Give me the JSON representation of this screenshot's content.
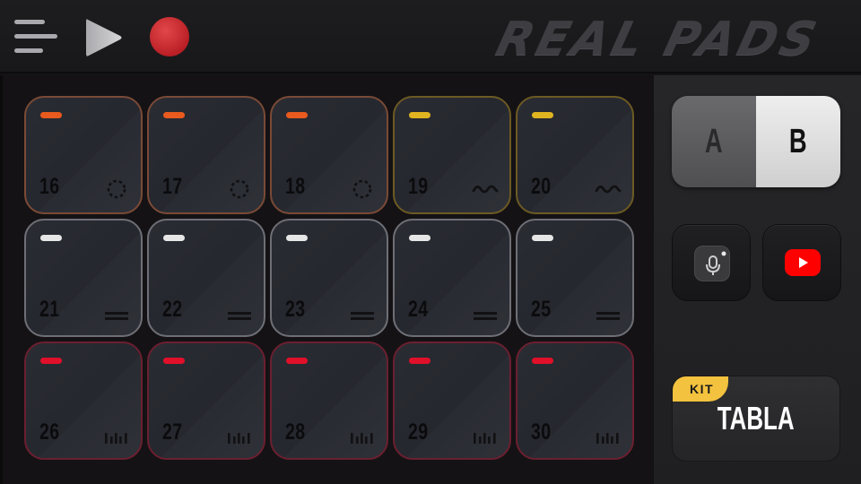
{
  "app": {
    "brand": "REAL PADS"
  },
  "toolbar": {
    "menu_icon": "hamburger-menu-icon",
    "play_icon": "play-icon",
    "record_icon": "record-icon"
  },
  "colors": {
    "orange": "#e85a1e",
    "yellow": "#e0b420",
    "white": "#e6e6e6",
    "red": "#e0102a",
    "orange_border": "#7a4a36",
    "yellow_border": "#6c5a23",
    "white_border": "#6e6f76",
    "red_border": "#6b1f30"
  },
  "pads": [
    {
      "number": "16",
      "color": "orange",
      "icon": "dotted-circle"
    },
    {
      "number": "17",
      "color": "orange",
      "icon": "dotted-circle"
    },
    {
      "number": "18",
      "color": "orange",
      "icon": "dotted-circle"
    },
    {
      "number": "19",
      "color": "yellow",
      "icon": "wave"
    },
    {
      "number": "20",
      "color": "yellow",
      "icon": "wave"
    },
    {
      "number": "21",
      "color": "white",
      "icon": "double-line"
    },
    {
      "number": "22",
      "color": "white",
      "icon": "double-line"
    },
    {
      "number": "23",
      "color": "white",
      "icon": "double-line"
    },
    {
      "number": "24",
      "color": "white",
      "icon": "double-line"
    },
    {
      "number": "25",
      "color": "white",
      "icon": "double-line"
    },
    {
      "number": "26",
      "color": "red",
      "icon": "bars"
    },
    {
      "number": "27",
      "color": "red",
      "icon": "bars"
    },
    {
      "number": "28",
      "color": "red",
      "icon": "bars"
    },
    {
      "number": "29",
      "color": "red",
      "icon": "bars"
    },
    {
      "number": "30",
      "color": "red",
      "icon": "bars"
    }
  ],
  "bank": {
    "a_label": "A",
    "b_label": "B",
    "selected": "B"
  },
  "buttons": {
    "mic_icon": "microphone-icon",
    "youtube_icon": "youtube-icon"
  },
  "kit": {
    "tag": "KIT",
    "name": "TABLA"
  }
}
